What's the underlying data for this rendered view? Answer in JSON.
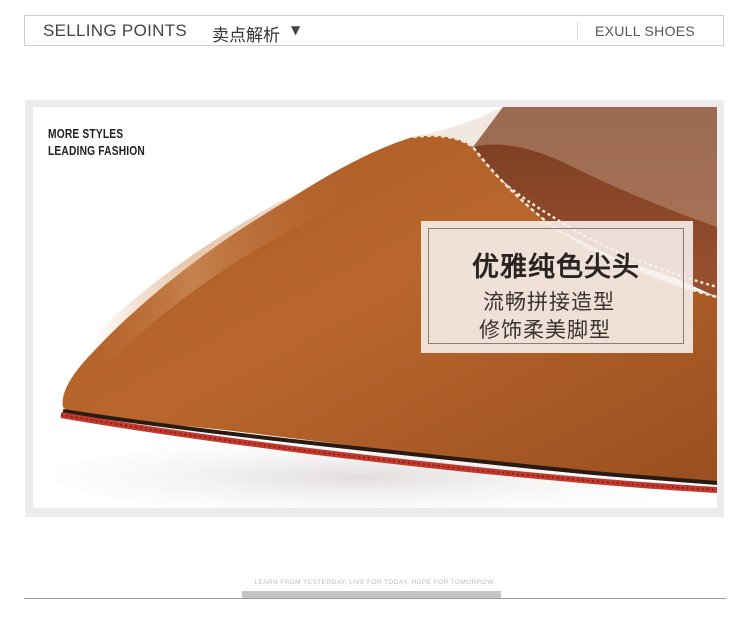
{
  "header": {
    "left_label": "SELLING POINTS",
    "cn_label": "卖点解析",
    "arrow": "▼",
    "right_label": "EXULL SHOES"
  },
  "photo": {
    "tagline_line1": "MORE STYLES",
    "tagline_line2": "LEADING FASHION",
    "icon": "pointed-toe-shoe-photo",
    "colors": {
      "leather": "#b5632a",
      "lining": "#8a4a2a",
      "sole": "#c23a2e",
      "stitch": "#f2e6d6"
    }
  },
  "callout": {
    "title": "优雅纯色尖头",
    "line1": "流畅拼接造型",
    "line2": "修饰柔美脚型"
  },
  "footer": {
    "slogan": "LEARN FROM YESTERDAY, LIVE FOR TODAY, HOPE FOR TOMORROW."
  }
}
